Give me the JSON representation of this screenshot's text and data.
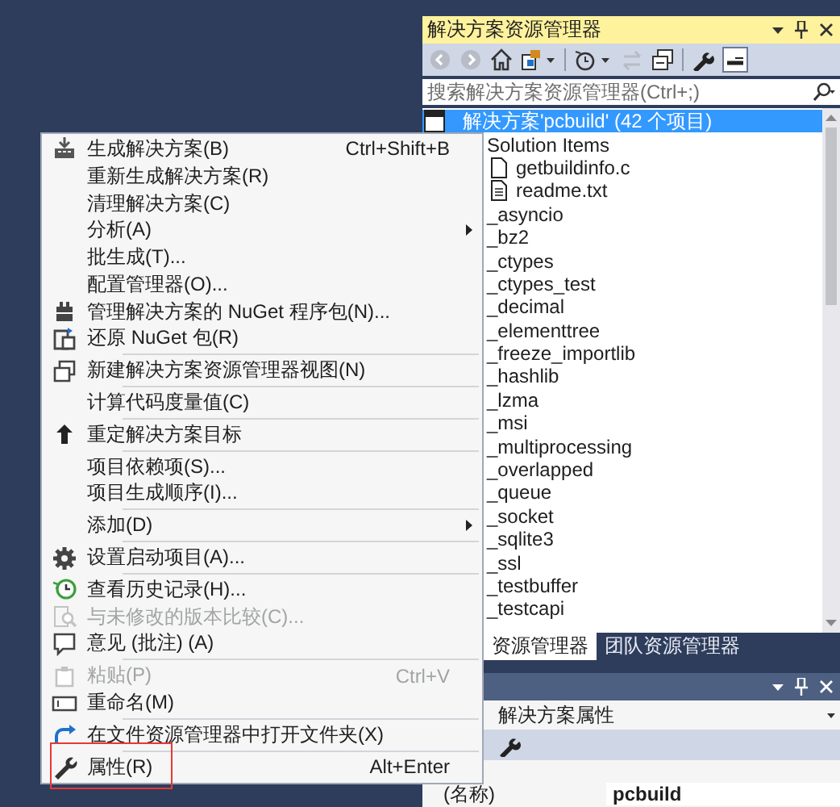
{
  "context_menu": {
    "groups": [
      [
        {
          "label": "生成解决方案(B)",
          "shortcut": "Ctrl+Shift+B",
          "submenu": false,
          "disabled": false,
          "outlined": false
        },
        {
          "label": "重新生成解决方案(R)",
          "submenu": false,
          "disabled": false,
          "outlined": false
        },
        {
          "label": "清理解决方案(C)",
          "submenu": false,
          "disabled": false,
          "outlined": false
        },
        {
          "label": "分析(A)",
          "submenu": true,
          "disabled": false,
          "outlined": false
        },
        {
          "label": "批生成(T)...",
          "submenu": false,
          "disabled": false,
          "outlined": false
        },
        {
          "label": "配置管理器(O)...",
          "submenu": false,
          "disabled": false,
          "outlined": false
        },
        {
          "label": "管理解决方案的 NuGet 程序包(N)...",
          "submenu": false,
          "disabled": false,
          "outlined": false
        },
        {
          "label": "还原 NuGet 包(R)",
          "submenu": false,
          "disabled": false,
          "outlined": false
        }
      ],
      [
        {
          "label": "新建解决方案资源管理器视图(N)",
          "submenu": false,
          "disabled": false,
          "outlined": false
        }
      ],
      [
        {
          "label": "计算代码度量值(C)",
          "submenu": false,
          "disabled": false,
          "outlined": false
        }
      ],
      [
        {
          "label": "重定解决方案目标",
          "submenu": false,
          "disabled": false,
          "outlined": false
        }
      ],
      [
        {
          "label": "项目依赖项(S)...",
          "submenu": false,
          "disabled": false,
          "outlined": false
        },
        {
          "label": "项目生成顺序(I)...",
          "submenu": false,
          "disabled": false,
          "outlined": false
        }
      ],
      [
        {
          "label": "添加(D)",
          "submenu": true,
          "disabled": false,
          "outlined": false
        }
      ],
      [
        {
          "label": "设置启动项目(A)...",
          "submenu": false,
          "disabled": false,
          "outlined": false
        }
      ],
      [
        {
          "label": "查看历史记录(H)...",
          "submenu": false,
          "disabled": false,
          "outlined": false
        },
        {
          "label": "与未修改的版本比较(C)...",
          "submenu": false,
          "disabled": true,
          "outlined": false
        },
        {
          "label": "意见 (批注) (A)",
          "submenu": false,
          "disabled": false,
          "outlined": false
        }
      ],
      [
        {
          "label": "粘贴(P)",
          "shortcut": "Ctrl+V",
          "submenu": false,
          "disabled": true,
          "outlined": false
        },
        {
          "label": "重命名(M)",
          "submenu": false,
          "disabled": false,
          "outlined": false
        }
      ],
      [
        {
          "label": "在文件资源管理器中打开文件夹(X)",
          "submenu": false,
          "disabled": false,
          "outlined": false
        }
      ],
      [
        {
          "label": "属性(R)",
          "shortcut": "Alt+Enter",
          "submenu": false,
          "disabled": false,
          "outlined": true
        }
      ]
    ]
  },
  "solution_explorer": {
    "title": "解决方案资源管理器",
    "search": {
      "placeholder": "搜索解决方案资源管理器(Ctrl+;)"
    },
    "tree": {
      "label": "解决方案'pcbuild' (42 个项目)",
      "kind": "solution",
      "selected": true,
      "children": [
        {
          "label": "Solution Items",
          "selected": false,
          "children": [
            {
              "label": "getbuildinfo.c",
              "kind": "file",
              "selected": false
            },
            {
              "label": "readme.txt",
              "kind": "text",
              "selected": false
            }
          ]
        },
        {
          "label": "_asyncio",
          "selected": false
        },
        {
          "label": "_bz2",
          "selected": false
        },
        {
          "label": "_ctypes",
          "selected": false
        },
        {
          "label": "_ctypes_test",
          "selected": false
        },
        {
          "label": "_decimal",
          "selected": false
        },
        {
          "label": "_elementtree",
          "selected": false
        },
        {
          "label": "_freeze_importlib",
          "selected": false
        },
        {
          "label": "_hashlib",
          "selected": false
        },
        {
          "label": "_lzma",
          "selected": false
        },
        {
          "label": "_msi",
          "selected": false
        },
        {
          "label": "_multiprocessing",
          "selected": false
        },
        {
          "label": "_overlapped",
          "selected": false
        },
        {
          "label": "_queue",
          "selected": false
        },
        {
          "label": "_socket",
          "selected": false
        },
        {
          "label": "_sqlite3",
          "selected": false
        },
        {
          "label": "_ssl",
          "selected": false
        },
        {
          "label": "_testbuffer",
          "selected": false
        },
        {
          "label": "_testcapi",
          "selected": false
        }
      ]
    },
    "tabs": [
      {
        "label": "资源管理器",
        "selected": true
      },
      {
        "label": "团队资源管理器",
        "selected": false
      }
    ]
  },
  "properties": {
    "object": "解决方案属性",
    "rows": [
      {
        "name": "(名称)",
        "value": "pcbuild"
      }
    ]
  }
}
